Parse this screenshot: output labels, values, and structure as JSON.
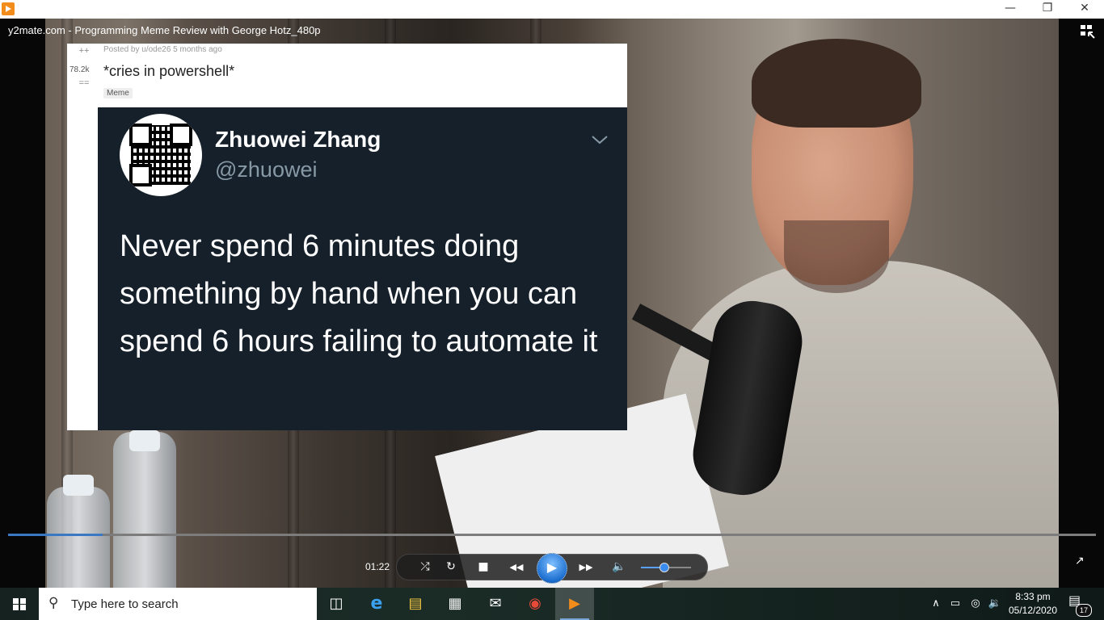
{
  "window": {
    "minimize": "—",
    "maximize": "❐",
    "close": "✕"
  },
  "video": {
    "title": "y2mate.com - Programming Meme Review with George Hotz_480p"
  },
  "meme": {
    "vote_up": "++",
    "score": "78.2k",
    "vote_down": "==",
    "posted": "Posted by u/ode26 5 months ago",
    "title": "*cries in powershell*",
    "flair": "Meme",
    "tweet_name": "Zhuowei Zhang",
    "tweet_handle": "@zhuowei",
    "tweet_text": "Never spend 6 minutes doing something by hand when you can spend 6 hours failing to automate it"
  },
  "player": {
    "elapsed": "01:22",
    "progress": 0.087,
    "volume": 0.45,
    "icons": {
      "shuffle": "⤮",
      "repeat": "↻",
      "stop": "■",
      "previous": "◀◀",
      "play": "▶",
      "next": "▶▶",
      "volume": "🔈",
      "fullscreen": "↗"
    }
  },
  "taskbar": {
    "search_placeholder": "Type here to search",
    "search_icon": "⚲",
    "apps": [
      {
        "name": "task-view",
        "glyph": "◫"
      },
      {
        "name": "edge",
        "glyph": "e"
      },
      {
        "name": "file-explorer",
        "glyph": "▤"
      },
      {
        "name": "store",
        "glyph": "▦"
      },
      {
        "name": "mail",
        "glyph": "✉"
      },
      {
        "name": "chrome",
        "glyph": "◉"
      },
      {
        "name": "media-player",
        "glyph": "▶"
      }
    ],
    "tray": {
      "chevron": "∧",
      "battery": "▭",
      "network": "◎",
      "volume": "🔉"
    },
    "time": "8:33 pm",
    "date": "05/12/2020",
    "notification_icon": "▤",
    "notification_count": "17"
  }
}
